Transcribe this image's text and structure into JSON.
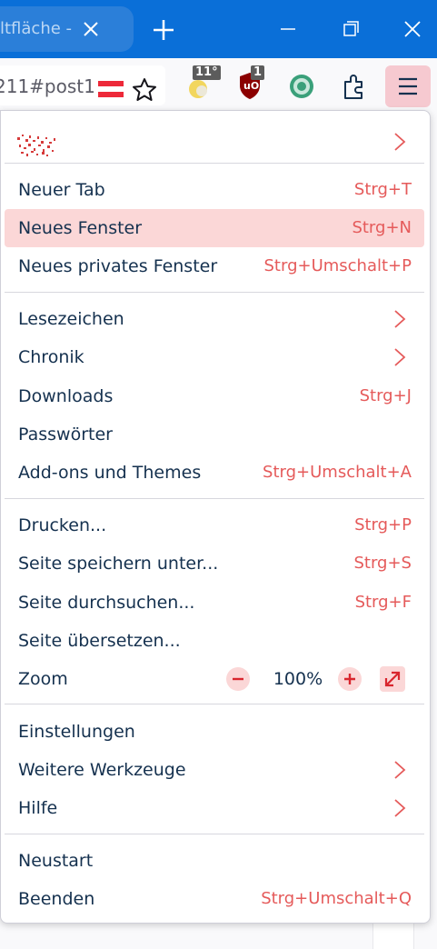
{
  "colors": {
    "titlebar": "#0a6fd8",
    "menu_highlight": "#fbd7d7",
    "shortcut_text": "#e55a5a",
    "label_text": "#15314f",
    "menu_button_bg": "#f6c9d0"
  },
  "titlebar": {
    "tab_title": "ltfläche - Go",
    "icons": [
      "close-icon",
      "plus-icon",
      "minimize-icon",
      "restore-icon",
      "close-window-icon"
    ]
  },
  "navbar": {
    "url_text": "211#post1",
    "extensions": {
      "weather_badge": "11°",
      "ublock_badge": "1"
    },
    "icons": [
      "austria-flag-icon",
      "star-icon",
      "weather-icon",
      "ublock-icon",
      "circle-extension-icon",
      "puzzle-icon",
      "hamburger-menu-icon"
    ]
  },
  "menu": {
    "account_icon": "account-avatar-icon",
    "new_tab": {
      "label": "Neuer Tab",
      "shortcut": "Strg+T"
    },
    "new_window": {
      "label": "Neues Fenster",
      "shortcut": "Strg+N"
    },
    "new_private_window": {
      "label": "Neues privates Fenster",
      "shortcut": "Strg+Umschalt+P"
    },
    "bookmarks": {
      "label": "Lesezeichen"
    },
    "history": {
      "label": "Chronik"
    },
    "downloads": {
      "label": "Downloads",
      "shortcut": "Strg+J"
    },
    "passwords": {
      "label": "Passwörter"
    },
    "addons": {
      "label": "Add-ons und Themes",
      "shortcut": "Strg+Umschalt+A"
    },
    "print": {
      "label": "Drucken...",
      "shortcut": "Strg+P"
    },
    "save_page": {
      "label": "Seite speichern unter...",
      "shortcut": "Strg+S"
    },
    "find": {
      "label": "Seite durchsuchen...",
      "shortcut": "Strg+F"
    },
    "translate": {
      "label": "Seite übersetzen..."
    },
    "zoom": {
      "label": "Zoom",
      "value": "100%"
    },
    "settings": {
      "label": "Einstellungen"
    },
    "more_tools": {
      "label": "Weitere Werkzeuge"
    },
    "help": {
      "label": "Hilfe"
    },
    "restart": {
      "label": "Neustart"
    },
    "quit": {
      "label": "Beenden",
      "shortcut": "Strg+Umschalt+Q"
    }
  }
}
